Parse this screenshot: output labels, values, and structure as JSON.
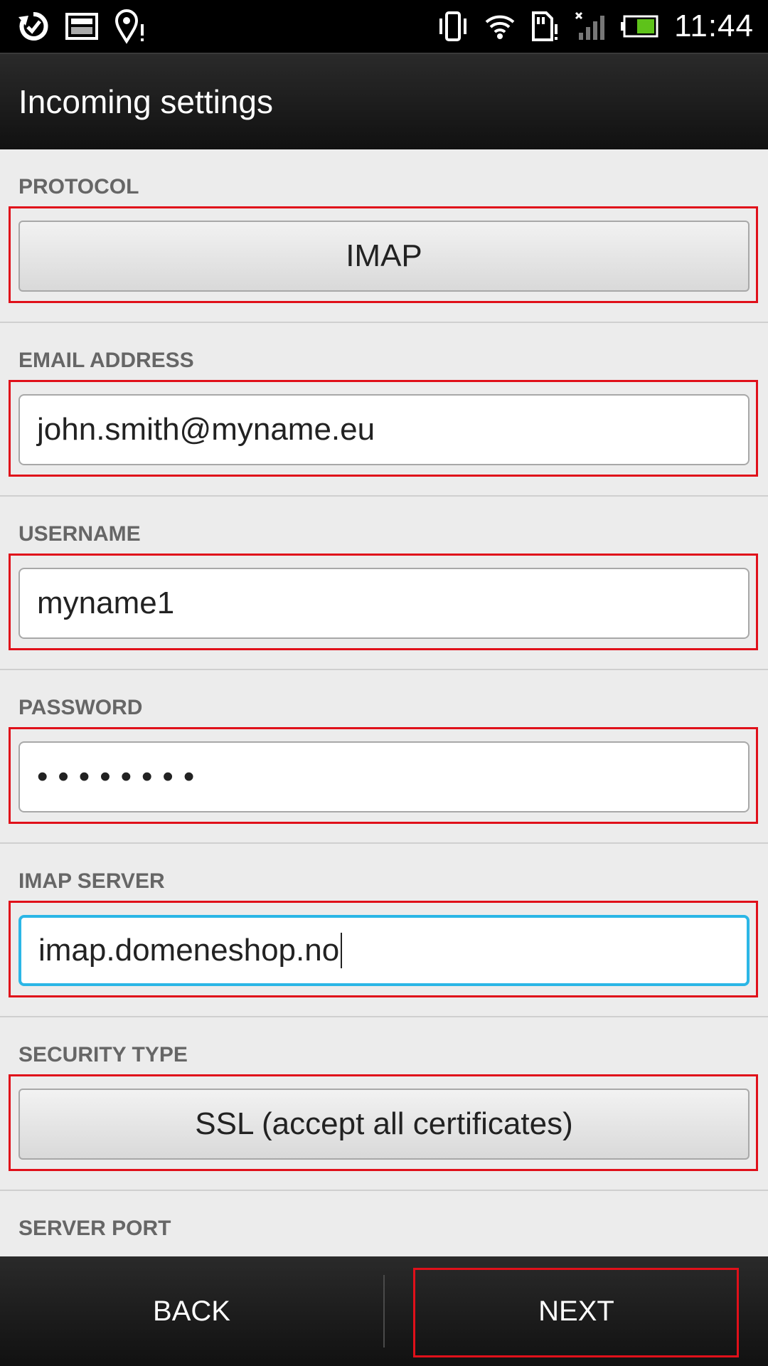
{
  "status_bar": {
    "time": "11:44",
    "icons_left": [
      "sync-icon",
      "image-icon",
      "location-alert-icon"
    ],
    "icons_right": [
      "vibrate-icon",
      "wifi-icon",
      "sd-card-alert-icon",
      "no-signal-icon",
      "battery-icon"
    ]
  },
  "action_bar": {
    "title": "Incoming settings"
  },
  "sections": {
    "protocol": {
      "label": "PROTOCOL",
      "value": "IMAP"
    },
    "email": {
      "label": "EMAIL ADDRESS",
      "value": "john.smith@myname.eu"
    },
    "username": {
      "label": "USERNAME",
      "value": "myname1"
    },
    "password": {
      "label": "PASSWORD",
      "value": "••••••••"
    },
    "imap_server": {
      "label": "IMAP SERVER",
      "value": "imap.domeneshop.no"
    },
    "security_type": {
      "label": "SECURITY TYPE",
      "value": "SSL (accept all certificates)"
    },
    "server_port": {
      "label": "SERVER PORT"
    }
  },
  "bottom_bar": {
    "back_label": "BACK",
    "next_label": "NEXT"
  },
  "colors": {
    "highlight": "#e0101a",
    "focus": "#2bb6e6"
  }
}
